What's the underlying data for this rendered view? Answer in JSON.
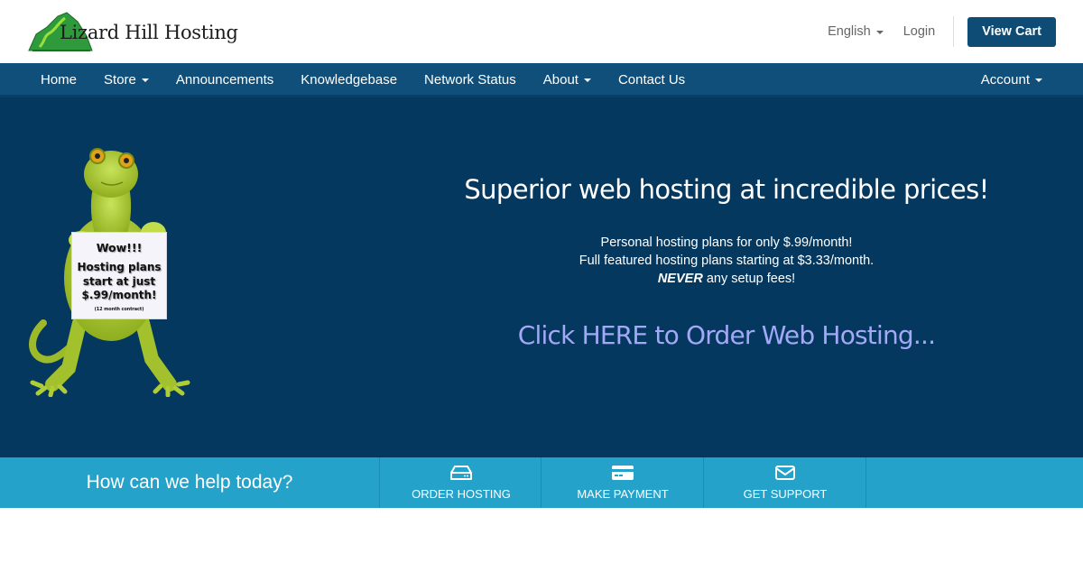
{
  "header": {
    "logo_text": "Lizard Hill Hosting",
    "language": "English",
    "login": "Login",
    "view_cart": "View Cart"
  },
  "navbar": {
    "items": [
      {
        "label": "Home",
        "dropdown": false
      },
      {
        "label": "Store",
        "dropdown": true
      },
      {
        "label": "Announcements",
        "dropdown": false
      },
      {
        "label": "Knowledgebase",
        "dropdown": false
      },
      {
        "label": "Network Status",
        "dropdown": false
      },
      {
        "label": "About",
        "dropdown": true
      },
      {
        "label": "Contact Us",
        "dropdown": false
      }
    ],
    "account": "Account"
  },
  "hero": {
    "sign": {
      "line1": "Wow!!!",
      "line2": "Hosting plans",
      "line3": "start at just",
      "line4": "$.99/month!",
      "line5": "(12 month contract)"
    },
    "title": "Superior web hosting at incredible prices!",
    "line1": "Personal hosting plans for only $.99/month!",
    "line2": "Full featured hosting plans starting at $3.33/month.",
    "line3_emphasis": "NEVER",
    "line3_rest": " any setup fees!",
    "order_link": "Click HERE to Order Web Hosting..."
  },
  "help_bar": {
    "title": "How can we help today?",
    "buttons": [
      {
        "label": "ORDER HOSTING",
        "icon": "server-icon"
      },
      {
        "label": "MAKE PAYMENT",
        "icon": "credit-card-icon"
      },
      {
        "label": "GET SUPPORT",
        "icon": "envelope-icon"
      }
    ]
  },
  "colors": {
    "brand_dark": "#0f4c75",
    "navbar": "#104f79",
    "hero_bg": "#05385f",
    "help_bar": "#24a2c9",
    "order_link": "#a3a8f7"
  }
}
